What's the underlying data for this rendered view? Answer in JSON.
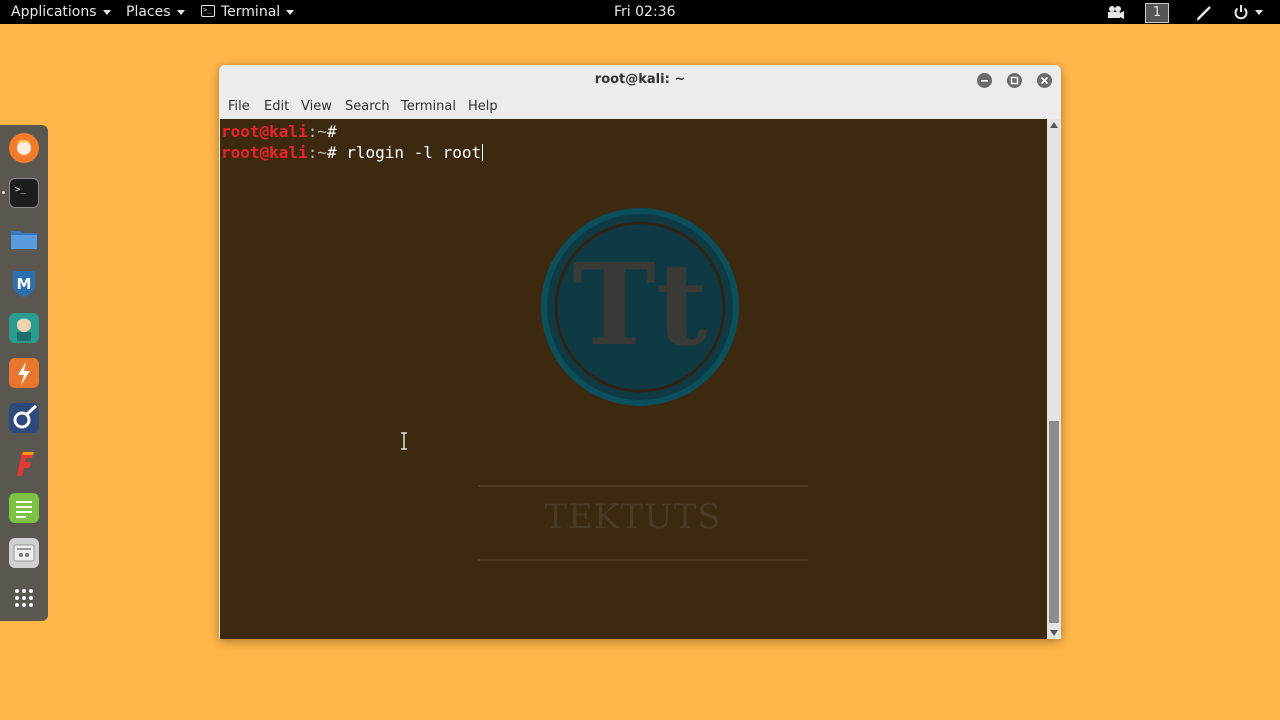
{
  "topbar": {
    "applications": "Applications",
    "places": "Places",
    "terminal": "Terminal",
    "clock": "Fri 02:36",
    "workspace": "1"
  },
  "dock": {
    "items": [
      {
        "name": "firefox-icon",
        "color": "#F47B2A"
      },
      {
        "name": "terminal-icon",
        "color": "#1d1d1d"
      },
      {
        "name": "files-icon",
        "color": "#4A90D9"
      },
      {
        "name": "metasploit-icon",
        "color": "#2C6FAE"
      },
      {
        "name": "armitage-icon",
        "color": "#2A9D8F"
      },
      {
        "name": "burpsuite-icon",
        "color": "#E8762C"
      },
      {
        "name": "maltego-icon",
        "color": "#2E4A7A"
      },
      {
        "name": "faraday-icon",
        "color": "#E53935"
      },
      {
        "name": "text-editor-icon",
        "color": "#7DC242"
      },
      {
        "name": "settings-icon",
        "color": "#D0D0D0"
      },
      {
        "name": "show-apps-icon",
        "color": "#FFFFFF"
      }
    ]
  },
  "window": {
    "title": "root@kali: ~",
    "menu": [
      "File",
      "Edit",
      "View",
      "Search",
      "Terminal",
      "Help"
    ]
  },
  "terminal": {
    "lines": [
      {
        "user": "root@kali",
        "path": ":~",
        "prompt": "# ",
        "command": ""
      },
      {
        "user": "root@kali",
        "path": ":~",
        "prompt": "# ",
        "command": "rlogin -l root"
      }
    ]
  },
  "watermark": {
    "monogram": "Tt",
    "brand": "TEKTUTS"
  }
}
